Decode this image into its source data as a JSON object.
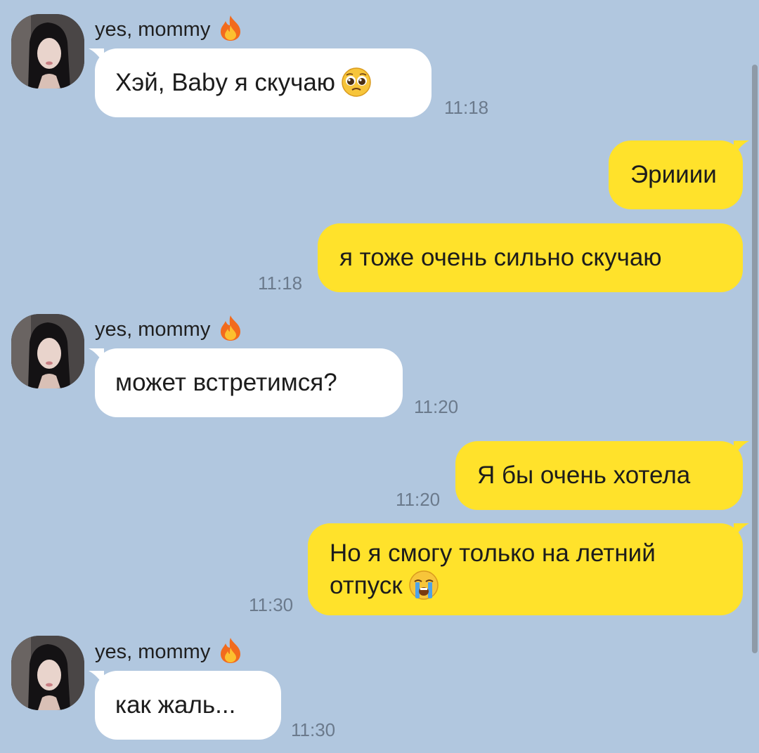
{
  "colors": {
    "background": "#b1c7df",
    "incoming_bubble": "#ffffff",
    "outgoing_bubble": "#ffe22b",
    "timestamp": "#6b7a8c",
    "scrollbar": "#8e9aa8"
  },
  "messages": [
    {
      "direction": "incoming",
      "sender": "yes, mommy",
      "sender_icon": "fire-icon",
      "text": "Хэй, Baby я скучаю",
      "emoji": "pleading-face-emoji",
      "time": "11:18"
    },
    {
      "direction": "outgoing",
      "text": "Эрииии",
      "time": ""
    },
    {
      "direction": "outgoing",
      "text": "я тоже очень сильно скучаю",
      "time": "11:18"
    },
    {
      "direction": "incoming",
      "sender": "yes, mommy",
      "sender_icon": "fire-icon",
      "text": "может встретимся?",
      "time": "11:20"
    },
    {
      "direction": "outgoing",
      "text": "Я бы очень хотела",
      "time": "11:20"
    },
    {
      "direction": "outgoing",
      "text_line1": "Но я смогу только на летний",
      "text_line2": "отпуск",
      "emoji": "loudly-crying-face-emoji",
      "time": "11:30"
    },
    {
      "direction": "incoming",
      "sender": "yes, mommy",
      "sender_icon": "fire-icon",
      "text": "как жаль...",
      "time": "11:30"
    }
  ]
}
